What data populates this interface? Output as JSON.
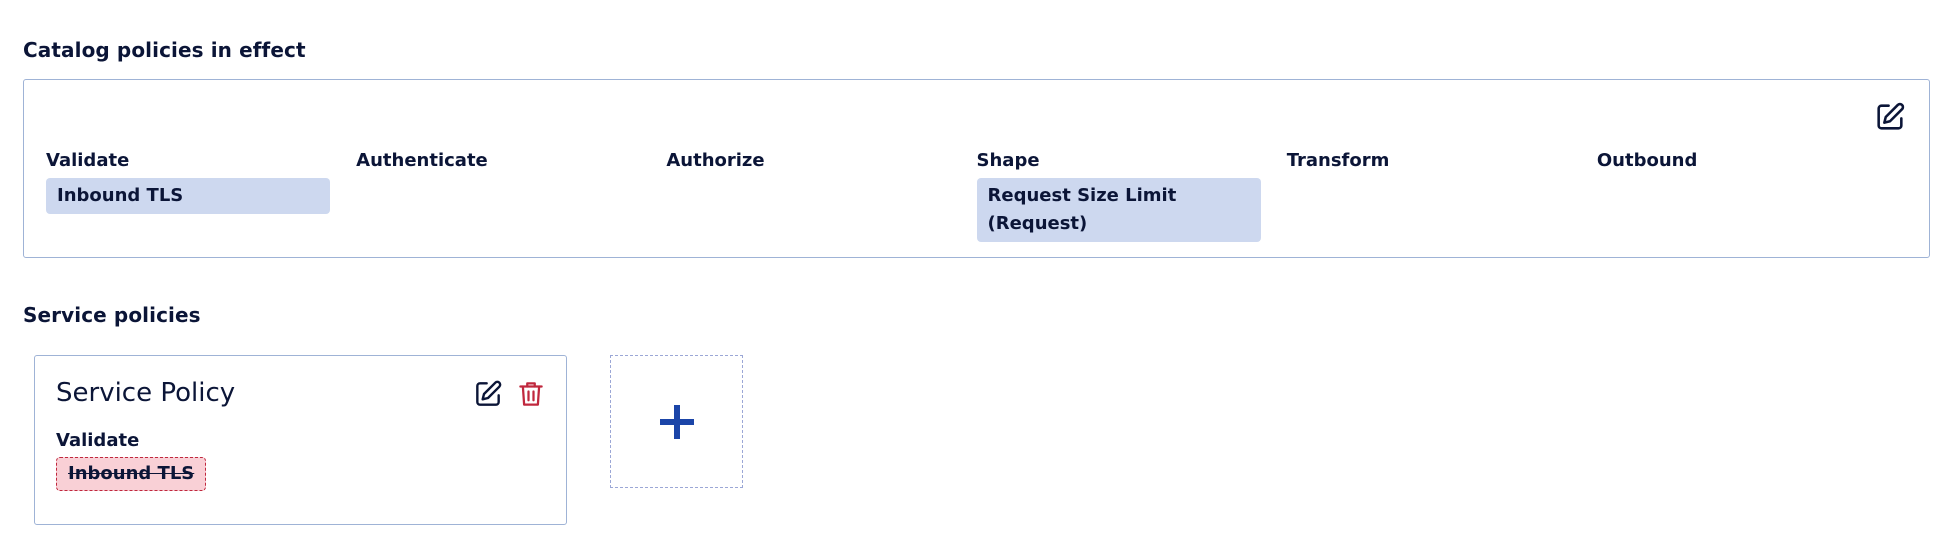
{
  "catalog": {
    "title": "Catalog policies in effect",
    "edit_icon": "edit-icon",
    "columns": [
      {
        "label": "Validate",
        "chips": [
          "Inbound TLS"
        ]
      },
      {
        "label": "Authenticate",
        "chips": []
      },
      {
        "label": "Authorize",
        "chips": []
      },
      {
        "label": "Shape",
        "chips": [
          "Request Size Limit (Request)"
        ]
      },
      {
        "label": "Transform",
        "chips": []
      },
      {
        "label": "Outbound",
        "chips": []
      }
    ]
  },
  "service": {
    "title": "Service policies",
    "card": {
      "title": "Service Policy",
      "edit_icon": "edit-icon",
      "delete_icon": "trash-icon",
      "stage_label": "Validate",
      "removed_chip": "Inbound TLS"
    },
    "add_icon": "plus-icon"
  },
  "colors": {
    "text": "#0b1537",
    "chip_bg": "#cdd8ef",
    "removed_bg": "#f9d0d6",
    "removed_border": "#c0283e",
    "delete_icon": "#c0283e",
    "add_icon": "#1b45a8",
    "panel_border": "#9fb3d6"
  }
}
